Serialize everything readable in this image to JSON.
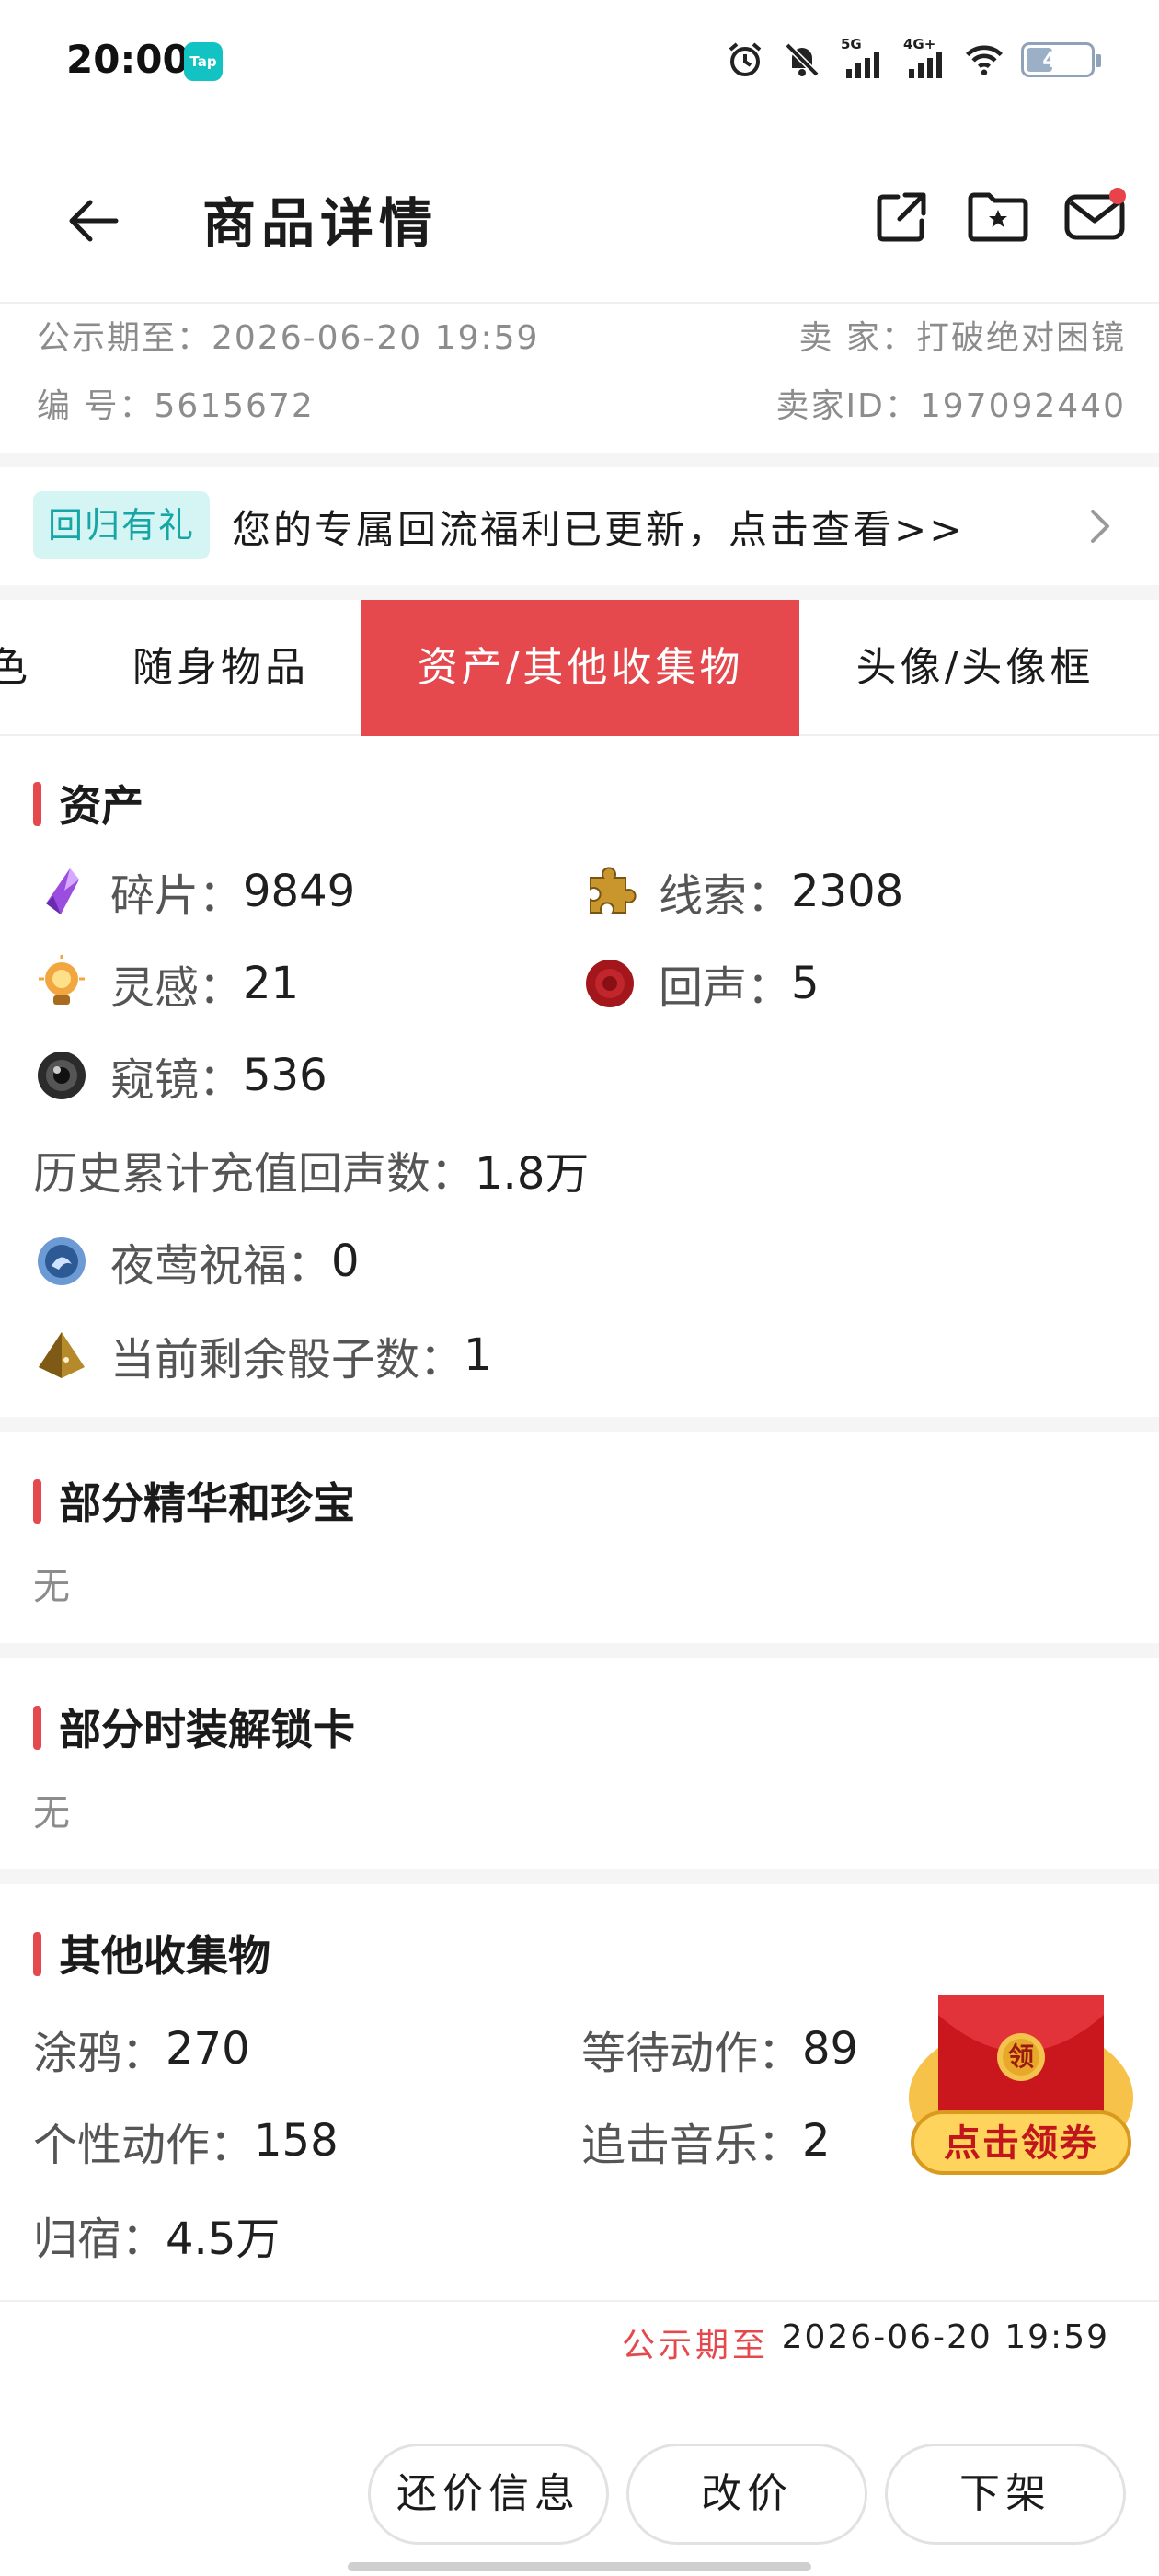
{
  "status_bar": {
    "time": "20:00",
    "tap_badge": "Tap",
    "net1": "5G",
    "net2": "4G+",
    "battery": "40",
    "icons": [
      "alarm-icon",
      "mute-bell-icon",
      "signal-5g-icon",
      "signal-4g-icon",
      "wifi-icon",
      "battery-icon"
    ]
  },
  "header": {
    "title": "商品详情",
    "icons": [
      "back-arrow-icon",
      "share-icon",
      "folder-star-icon",
      "mail-icon"
    ]
  },
  "meta": {
    "publicity_label": "公示期至：2026-06-20 19:59",
    "seller_label": "卖 家：打破绝对困镜",
    "serial_label": "编 号：5615672",
    "seller_id_label": "卖家ID：197092440"
  },
  "promo": {
    "badge": "回归有礼",
    "text": "您的专属回流福利已更新，点击查看>>"
  },
  "tabs": [
    {
      "label": "色",
      "active": false
    },
    {
      "label": "随身物品",
      "active": false
    },
    {
      "label": "资产/其他收集物",
      "active": true
    },
    {
      "label": "头像/头像框",
      "active": false
    }
  ],
  "assets": {
    "title": "资产",
    "items": [
      {
        "key": "碎片：",
        "value": "9849",
        "icon": "purple-crystal-icon"
      },
      {
        "key": "线索：",
        "value": "2308",
        "icon": "puzzle-piece-icon"
      },
      {
        "key": "灵感：",
        "value": "21",
        "icon": "lightbulb-icon"
      },
      {
        "key": "回声：",
        "value": "5",
        "icon": "wax-seal-icon"
      },
      {
        "key": "窥镜：",
        "value": "536",
        "icon": "lens-icon"
      },
      {
        "key": "历史累计充值回声数：",
        "value": "1.8万"
      },
      {
        "key": "夜莺祝福：",
        "value": "0",
        "icon": "nightingale-orb-icon"
      },
      {
        "key": "当前剩余骰子数：",
        "value": "1",
        "icon": "dice-icon"
      }
    ]
  },
  "essence": {
    "title": "部分精华和珍宝",
    "value": "无"
  },
  "costume": {
    "title": "部分时装解锁卡",
    "value": "无"
  },
  "collectibles": {
    "title": "其他收集物",
    "items": [
      {
        "key": "涂鸦：",
        "value": "270"
      },
      {
        "key": "等待动作：",
        "value": "89"
      },
      {
        "key": "个性动作：",
        "value": "158"
      },
      {
        "key": "追击音乐：",
        "value": "2"
      },
      {
        "key": "归宿：",
        "value": "4.5万"
      }
    ]
  },
  "coupon": {
    "seal": "领",
    "label": "点击领券"
  },
  "footer": {
    "publicity_label": "公示期至",
    "publicity_date": "2026-06-20 19:59",
    "buttons": {
      "counter_offer": "还价信息",
      "change_price": "改价",
      "take_down": "下架"
    }
  },
  "colors": {
    "accent": "#e5484d",
    "promo_bg": "#d5f4f4",
    "promo_fg": "#17a6a6"
  }
}
